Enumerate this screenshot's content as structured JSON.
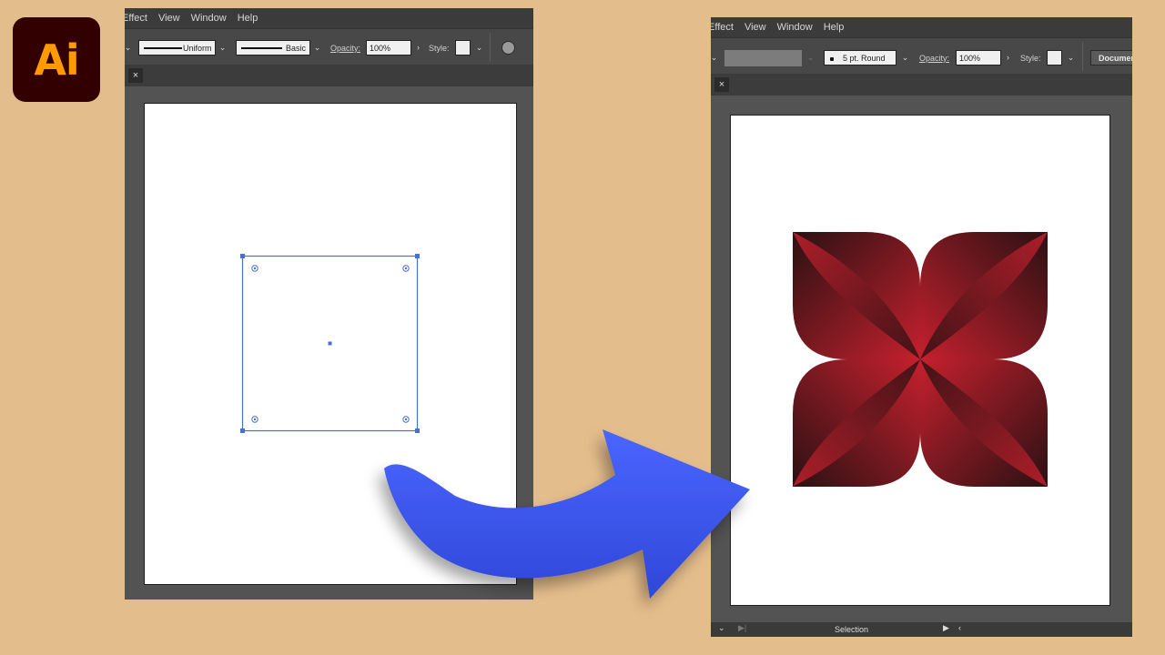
{
  "app": {
    "logo_text": "Ai",
    "logo_bg": "#330000",
    "logo_fg": "#ff9a00"
  },
  "left_window": {
    "menu": [
      "Effect",
      "View",
      "Window",
      "Help"
    ],
    "control": {
      "stroke_profile": "Uniform",
      "brush": "Basic",
      "opacity_label": "Opacity:",
      "opacity_value": "100%",
      "style_label": "Style:"
    },
    "tab_close": "×"
  },
  "right_window": {
    "menu": [
      "Effect",
      "View",
      "Window",
      "Help"
    ],
    "control": {
      "brush_label": "5 pt. Round",
      "opacity_label": "Opacity:",
      "opacity_value": "100%",
      "style_label": "Style:",
      "document_button": "Documen"
    },
    "tab_close": "×",
    "status": {
      "tool": "Selection"
    }
  },
  "colors": {
    "background": "#e4bd8c",
    "selection": "#4a6fd1",
    "arrow": "#3b56e6",
    "petal_dark": "#2b1113",
    "petal_light": "#c4202d"
  }
}
